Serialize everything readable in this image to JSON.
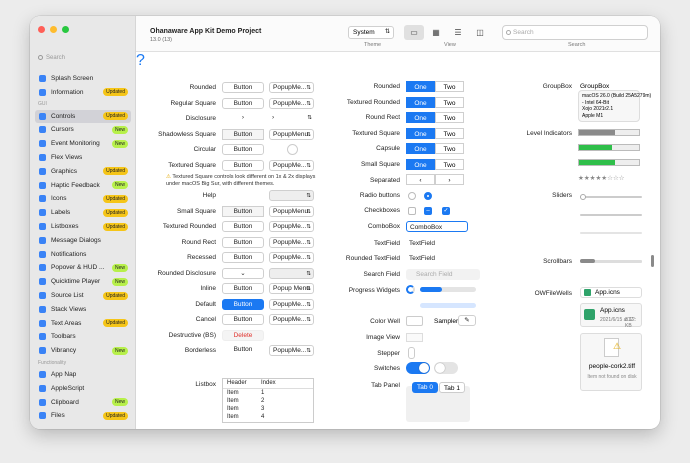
{
  "sidebar": {
    "search_placeholder": "Search",
    "items_top": [
      {
        "label": "Splash Screen"
      },
      {
        "label": "Information",
        "badge": "Updated"
      }
    ],
    "gui_header": "GUI",
    "items_gui": [
      {
        "label": "Controls",
        "badge": "Updated",
        "selected": true
      },
      {
        "label": "Cursors",
        "badge": "New"
      },
      {
        "label": "Event Monitoring",
        "badge": "New"
      },
      {
        "label": "Flex Views"
      },
      {
        "label": "Graphics",
        "badge": "Updated"
      },
      {
        "label": "Haptic Feedback",
        "badge": "New"
      },
      {
        "label": "Icons",
        "badge": "Updated"
      },
      {
        "label": "Labels",
        "badge": "Updated"
      },
      {
        "label": "Listboxes",
        "badge": "Updated"
      },
      {
        "label": "Message Dialogs"
      },
      {
        "label": "Notifications"
      },
      {
        "label": "Popover & HUD ...",
        "badge": "New"
      },
      {
        "label": "Quicktime Player",
        "badge": "New"
      },
      {
        "label": "Source List",
        "badge": "Updated"
      },
      {
        "label": "Stack Views"
      },
      {
        "label": "Text Areas",
        "badge": "Updated"
      },
      {
        "label": "Toolbars"
      },
      {
        "label": "Vibrancy",
        "badge": "New"
      }
    ],
    "func_header": "Functionality",
    "items_func": [
      {
        "label": "App Nap"
      },
      {
        "label": "AppleScript"
      },
      {
        "label": "Clipboard",
        "badge": "New"
      },
      {
        "label": "Files",
        "badge": "Updated"
      }
    ]
  },
  "toolbar": {
    "title": "Ohanaware App Kit Demo Project",
    "subtitle": "13.0 (13)",
    "theme_value": "System",
    "theme_label": "Theme",
    "view_label": "View",
    "search_label": "Search",
    "search_placeholder": "Search"
  },
  "col1": {
    "rows": [
      {
        "label": "Rounded",
        "btn": "Button",
        "pop": "PopupMe..."
      },
      {
        "label": "Regular Square",
        "btn": "Button",
        "pop": "PopupMe..."
      },
      {
        "label": "Disclosure",
        "btn": "›",
        "pop": "›"
      },
      {
        "label": "Shadowless Square",
        "btn": "Button",
        "pop": "PopupMenu"
      },
      {
        "label": "Circular",
        "btn": "Button",
        "pop": ""
      },
      {
        "label": "Textured Square",
        "btn": "Button",
        "pop": "PopupMe..."
      }
    ],
    "note": "Textured Square controls look different on 1x & 2x displays under macOS Big Sur, with different themes.",
    "rows2": [
      {
        "label": "Help",
        "btn": "?",
        "pop": ""
      },
      {
        "label": "Small Square",
        "btn": "Button",
        "pop": "PopupMenu"
      },
      {
        "label": "Textured Rounded",
        "btn": "Button",
        "pop": "PopupMe..."
      },
      {
        "label": "Round Rect",
        "btn": "Button",
        "pop": "PopupMe..."
      },
      {
        "label": "Recessed",
        "btn": "Button",
        "pop": "PopupMe..."
      },
      {
        "label": "Rounded Disclosure",
        "btn": "⌄",
        "pop": ""
      },
      {
        "label": "Inline",
        "btn": "Button",
        "pop": "Popup Menu"
      },
      {
        "label": "Default",
        "btn": "Button",
        "pop": "PopupMe..."
      },
      {
        "label": "Cancel",
        "btn": "Button",
        "pop": "PopupMe..."
      },
      {
        "label": "Destructive (BS)",
        "btn": "Delete",
        "pop": ""
      },
      {
        "label": "Borderless",
        "btn": "Button",
        "pop": "PopupMe..."
      }
    ],
    "listbox_label": "Listbox",
    "listbox_headers": [
      "Header",
      "Index"
    ],
    "listbox_rows": [
      {
        "a": "Item",
        "b": "1"
      },
      {
        "a": "Item",
        "b": "2"
      },
      {
        "a": "Item",
        "b": "3"
      },
      {
        "a": "Item",
        "b": "4"
      }
    ]
  },
  "col2": {
    "seg_rows": [
      {
        "label": "Rounded",
        "one": "One",
        "two": "Two"
      },
      {
        "label": "Textured Rounded",
        "one": "One",
        "two": "Two"
      },
      {
        "label": "Round Rect",
        "one": "One",
        "two": "Two"
      },
      {
        "label": "Textured Square",
        "one": "One",
        "two": "Two"
      },
      {
        "label": "Capsule",
        "one": "One",
        "two": "Two"
      },
      {
        "label": "Small Square",
        "one": "One",
        "two": "Two"
      }
    ],
    "separated_label": "Separated",
    "separated_left": "‹",
    "separated_right": "›",
    "radio_label": "Radio buttons",
    "checkbox_label": "Checkboxes",
    "combobox_label": "ComboBox",
    "combobox_value": "ComboBox",
    "textfield_label": "TextField",
    "textfield_value": "TextField",
    "rounded_tf_label": "Rounded TextField",
    "rounded_tf_value": "TextField",
    "searchfield_label": "Search Field",
    "searchfield_placeholder": "Search Field",
    "progress_label": "Progress Widgets",
    "progress_value": 0.4,
    "colorwell_label": "Color Well",
    "sampler_label": "Sampler",
    "imageview_label": "Image View",
    "stepper_label": "Stepper",
    "switches_label": "Switches",
    "tabpanel_label": "Tab Panel",
    "tab0": "Tab 0",
    "tab1": "Tab 1"
  },
  "col3": {
    "groupbox_label": "GroupBox",
    "groupbox_title": "GroupBox",
    "groupbox_lines": [
      "macOS 26.0 (Build 25A5279m)",
      "- Intel 64-Bit",
      "Xojo 2021r2.1",
      "Apple M1"
    ],
    "level_label": "Level Indicators",
    "levels": [
      0.6,
      0.55,
      0.6
    ],
    "rating_stars": "★★★★★☆☆☆",
    "sliders_label": "Sliders",
    "scrollbars_label": "Scrollbars",
    "owf_label": "OWFileWells",
    "file1": "App.icns",
    "file2_name": "App.icns",
    "file2_date": "2021/6/15 at 12:",
    "file2_size": "317 KB",
    "file3_name": "people-cork2.tiff",
    "file3_status": "Item not found on disk"
  },
  "colors": {
    "accent": "#1b79f2",
    "badge_updated": "#f5c518",
    "badge_new": "#b7f04a",
    "level_gray": "#8a8a8a",
    "level_green": "#2fbf4a"
  }
}
